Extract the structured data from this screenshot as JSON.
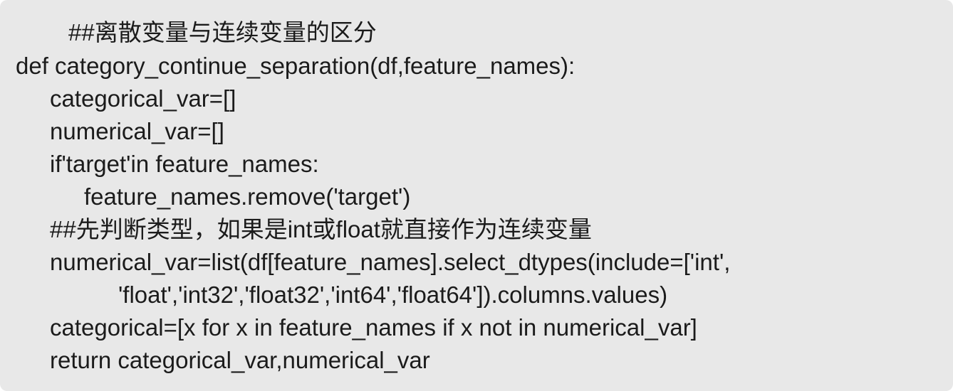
{
  "code_snippet": {
    "lines": [
      "##离散变量与连续变量的区分",
      "def category_continue_separation(df,feature_names):",
      "categorical_var=[]",
      "numerical_var=[]",
      "if'target'in feature_names:",
      "feature_names.remove('target')",
      "##先判断类型，如果是int或float就直接作为连续变量",
      "numerical_var=list(df[feature_names].select_dtypes(include=['int',",
      "'float','int32','float32','int64','float64']).columns.values)",
      "categorical=[x for x in feature_names if x not in numerical_var]",
      "return categorical_var,numerical_var"
    ]
  }
}
